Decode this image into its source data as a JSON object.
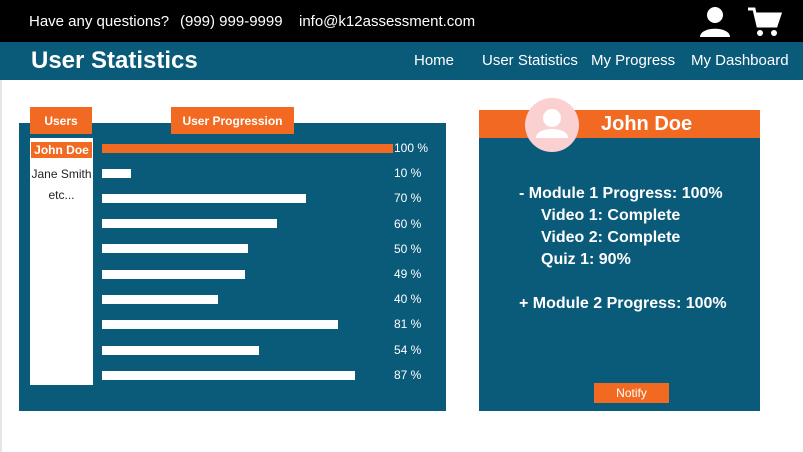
{
  "topbar": {
    "question": "Have any questions?",
    "phone": "(999) 999-9999",
    "email": "info@k12assessment.com"
  },
  "navbar": {
    "brand": "User Statistics",
    "items": [
      "Home",
      "User Statistics",
      "My Progress",
      "My Dashboard"
    ]
  },
  "stats": {
    "users_tab": "Users",
    "progression_tab": "User Progression",
    "users": [
      "John Doe",
      "Jane Smith",
      "etc..."
    ],
    "progress": [
      {
        "value": 100,
        "label": "100 %"
      },
      {
        "value": 10,
        "label": "10 %"
      },
      {
        "value": 70,
        "label": "70 %"
      },
      {
        "value": 60,
        "label": "60 %"
      },
      {
        "value": 50,
        "label": "50 %"
      },
      {
        "value": 49,
        "label": "49 %"
      },
      {
        "value": 40,
        "label": "40 %"
      },
      {
        "value": 81,
        "label": "81 %"
      },
      {
        "value": 54,
        "label": "54 %"
      },
      {
        "value": 87,
        "label": "87 %"
      }
    ]
  },
  "profile": {
    "name": "John Doe",
    "details": [
      "- Module 1 Progress: 100%",
      "Video 1: Complete",
      "Video 2: Complete",
      "Quiz 1: 90%",
      "+ Module 2 Progress: 100%"
    ],
    "notify_label": "Notify"
  },
  "colors": {
    "accent": "#f26a22",
    "panel": "#0a5a7a",
    "topbar": "#000000"
  },
  "icons": {
    "account": "user-icon",
    "cart": "cart-icon",
    "avatar": "avatar-icon"
  }
}
